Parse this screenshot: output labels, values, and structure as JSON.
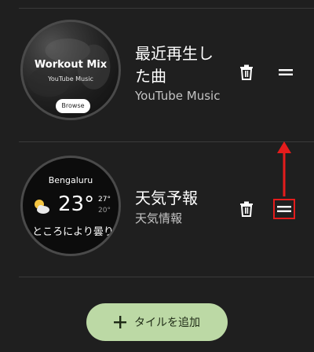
{
  "tiles": [
    {
      "title": "最近再生した曲",
      "subtitle": "YouTube Music",
      "preview": {
        "headline": "Workout Mix",
        "sub": "YouTube Music",
        "button": "Browse"
      },
      "delete_icon": "trash-icon",
      "drag_icon": "drag-handle-icon"
    },
    {
      "title": "天気予報",
      "subtitle": "天気情報",
      "preview": {
        "city": "Bengaluru",
        "temp": "23°",
        "high": "27°",
        "low": "20°",
        "condition": "ところにより曇り",
        "weather_icon": "partly-cloudy-icon"
      },
      "delete_icon": "trash-icon",
      "drag_icon": "drag-handle-icon"
    }
  ],
  "add_button": {
    "label": "タイルを追加",
    "icon": "plus-icon"
  },
  "colors": {
    "background": "#1f1f1f",
    "accent": "#bcd9a5",
    "annotation": "#e51c1c"
  }
}
